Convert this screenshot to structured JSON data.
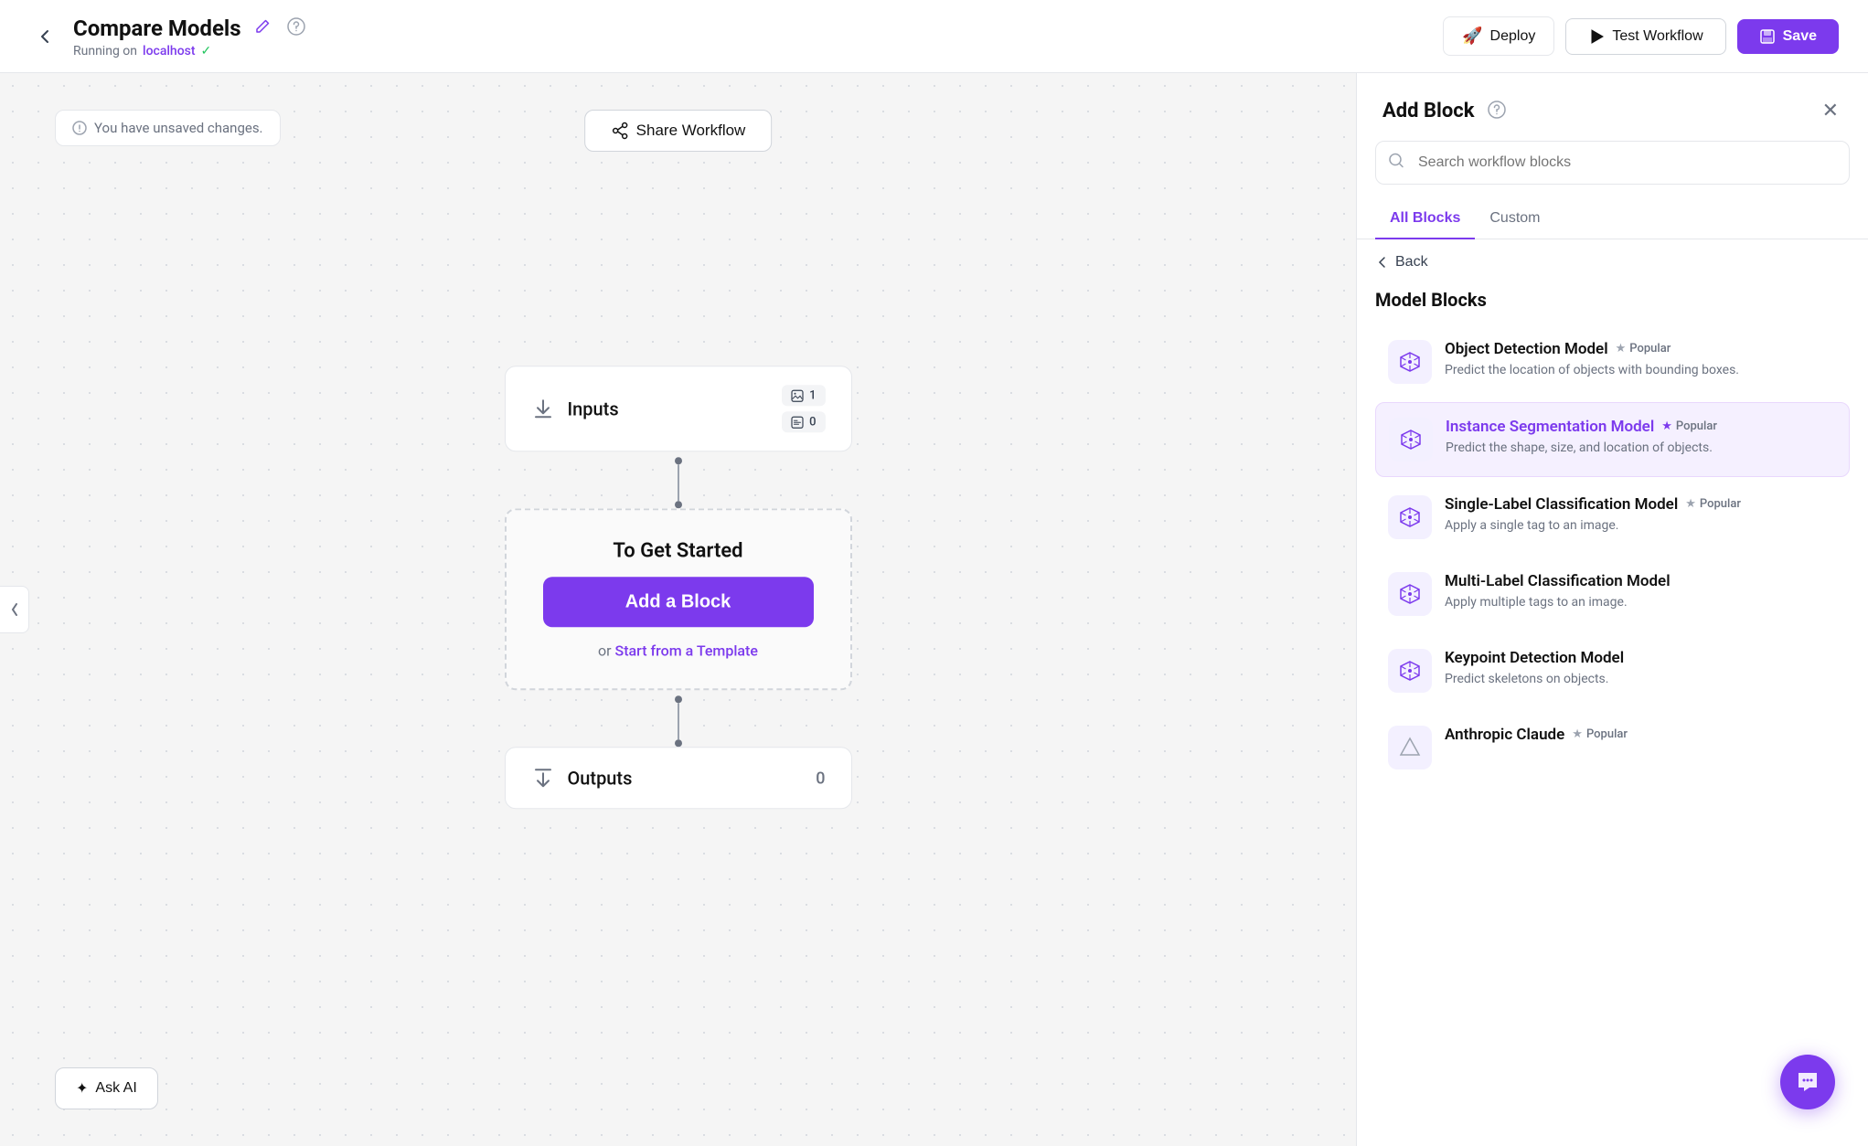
{
  "header": {
    "back_label": "←",
    "title": "Compare Models",
    "subtitle_prefix": "Running on",
    "host": "localhost",
    "deploy_label": "Deploy",
    "test_label": "Test Workflow",
    "save_label": "Save"
  },
  "canvas": {
    "unsaved_label": "You have unsaved changes.",
    "share_label": "Share Workflow",
    "ask_ai_label": "✦ Ask AI",
    "nodes": {
      "inputs_label": "Inputs",
      "inputs_badge1": "1",
      "inputs_badge2": "0",
      "to_get_started": "To Get Started",
      "add_block_label": "Add a Block",
      "or_text": "or",
      "template_link": "Start from a Template",
      "outputs_label": "Outputs",
      "outputs_count": "0"
    }
  },
  "panel": {
    "title": "Add Block",
    "search_placeholder": "Search workflow blocks",
    "tabs": [
      {
        "label": "All Blocks",
        "active": true
      },
      {
        "label": "Custom",
        "active": false
      }
    ],
    "back_label": "← Back",
    "section_title": "Model Blocks",
    "blocks": [
      {
        "name": "Object Detection Model",
        "popular": true,
        "popular_label": "Popular",
        "desc": "Predict the location of objects with bounding boxes.",
        "highlighted": false,
        "purple_name": false
      },
      {
        "name": "Instance Segmentation Model",
        "popular": true,
        "popular_label": "Popular",
        "desc": "Predict the shape, size, and location of objects.",
        "highlighted": true,
        "purple_name": true
      },
      {
        "name": "Single-Label Classification Model",
        "popular": true,
        "popular_label": "Popular",
        "desc": "Apply a single tag to an image.",
        "highlighted": false,
        "purple_name": false
      },
      {
        "name": "Multi-Label Classification Model",
        "popular": false,
        "popular_label": "",
        "desc": "Apply multiple tags to an image.",
        "highlighted": false,
        "purple_name": false
      },
      {
        "name": "Keypoint Detection Model",
        "popular": false,
        "popular_label": "",
        "desc": "Predict skeletons on objects.",
        "highlighted": false,
        "purple_name": false
      },
      {
        "name": "Anthropic Claude",
        "popular": true,
        "popular_label": "Popular",
        "desc": "",
        "highlighted": false,
        "purple_name": false
      }
    ]
  },
  "icons": {
    "model_icon": "⬡",
    "anthropic_icon": "△"
  }
}
